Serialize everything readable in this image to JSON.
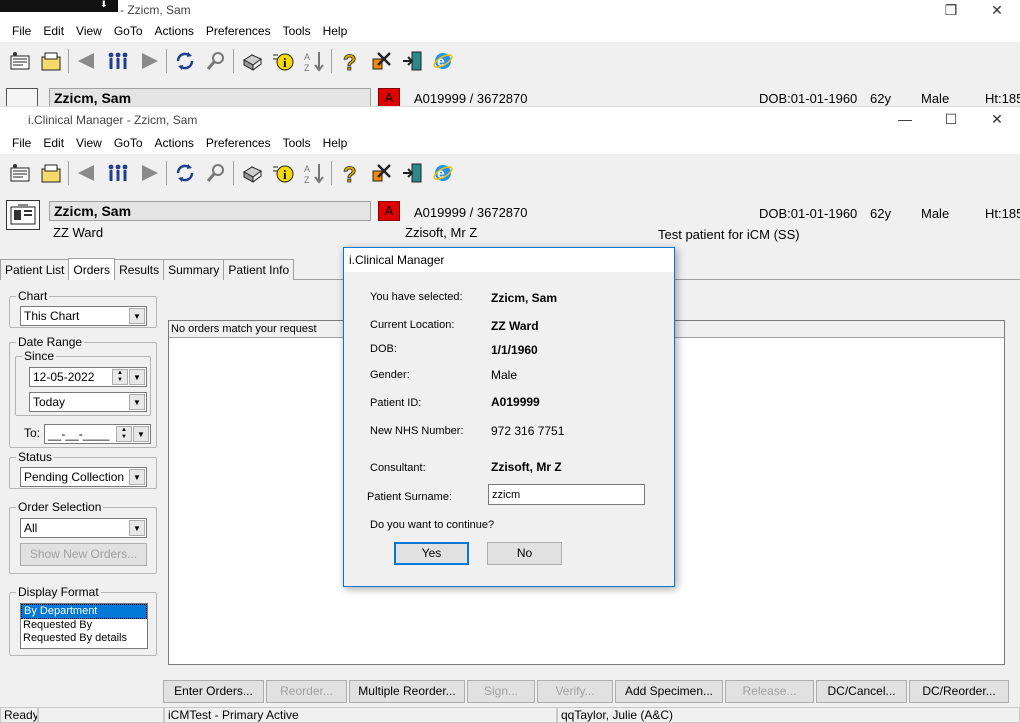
{
  "back_window": {
    "title": "- Zzicm, Sam",
    "menu": [
      "File",
      "Edit",
      "View",
      "GoTo",
      "Actions",
      "Preferences",
      "Tools",
      "Help"
    ],
    "patient_name": "Zzicm, Sam",
    "alert": "A",
    "patient_ids": "A019999 / 3672870",
    "dob": "DOB:01-01-1960",
    "age": "62y",
    "gender": "Male",
    "height": "Ht:185"
  },
  "window": {
    "title": "i.Clinical Manager - Zzicm, Sam",
    "controls": {
      "minimize": "—",
      "maximize": "☐",
      "close": "✕"
    },
    "menu": [
      "File",
      "Edit",
      "View",
      "GoTo",
      "Actions",
      "Preferences",
      "Tools",
      "Help"
    ]
  },
  "patient": {
    "name": "Zzicm, Sam",
    "alert": "A",
    "ids": "A019999 / 3672870",
    "ward": "ZZ Ward",
    "consultant": "Zzisoft, Mr Z",
    "dob": "DOB:01-01-1960",
    "age": "62y",
    "gender": "Male",
    "height": "Ht:185",
    "note": "Test patient for iCM (SS)"
  },
  "tabs": [
    {
      "label": "Patient List",
      "active": false
    },
    {
      "label": "Orders",
      "active": true
    },
    {
      "label": "Results",
      "active": false
    },
    {
      "label": "Summary",
      "active": false
    },
    {
      "label": "Patient Info",
      "active": false
    }
  ],
  "filters": {
    "chart_label": "Chart",
    "chart_value": "This Chart",
    "date_range_label": "Date Range",
    "since_label": "Since",
    "since_date": "12-05-2022",
    "since_period": "Today",
    "to_label": "To:",
    "to_date": "__-__-____",
    "status_label": "Status",
    "status_value": "Pending Collection",
    "order_selection_label": "Order Selection",
    "order_selection_value": "All",
    "show_new_orders": "Show New Orders...",
    "display_format_label": "Display Format",
    "display_format_options": [
      "By Department",
      "Requested By",
      "Requested By details"
    ],
    "display_format_selected": 0
  },
  "results": {
    "header": "No orders match your request"
  },
  "action_buttons": [
    {
      "label": "Enter Orders...",
      "enabled": true
    },
    {
      "label": "Reorder...",
      "enabled": false
    },
    {
      "label": "Multiple Reorder...",
      "enabled": true
    },
    {
      "label": "Sign...",
      "enabled": false
    },
    {
      "label": "Verify...",
      "enabled": false
    },
    {
      "label": "Add Specimen...",
      "enabled": true
    },
    {
      "label": "Release...",
      "enabled": false
    },
    {
      "label": "DC/Cancel...",
      "enabled": true
    },
    {
      "label": "DC/Reorder...",
      "enabled": true
    }
  ],
  "status_bar": {
    "state": "Ready",
    "environment": "iCMTest - Primary Active",
    "user": "qqTaylor, Julie  (A&C)"
  },
  "dialog": {
    "title": "i.Clinical Manager",
    "selected_label": "You have selected:",
    "selected_value": "Zzicm, Sam",
    "location_label": "Current Location:",
    "location_value": "ZZ Ward",
    "dob_label": "DOB:",
    "dob_value": "1/1/1960",
    "gender_label": "Gender:",
    "gender_value": "Male",
    "patient_id_label": "Patient ID:",
    "patient_id_value": "A019999",
    "nhs_label": "New NHS Number:",
    "nhs_value": "972 316 7751",
    "consultant_label": "Consultant:",
    "consultant_value": "Zzisoft, Mr Z",
    "surname_label": "Patient Surname:",
    "surname_value": "zzicm",
    "question": "Do you want to continue?",
    "yes": "Yes",
    "no": "No"
  },
  "icons": [
    "patient-list-icon",
    "chart-icon",
    "back-icon",
    "people-icon",
    "forward-icon",
    "refresh-icon",
    "search-icon",
    "print-icon",
    "info-icon",
    "sort-icon",
    "help-icon",
    "tools-icon",
    "exit-icon",
    "internet-explorer-icon",
    "patient-card-icon"
  ]
}
